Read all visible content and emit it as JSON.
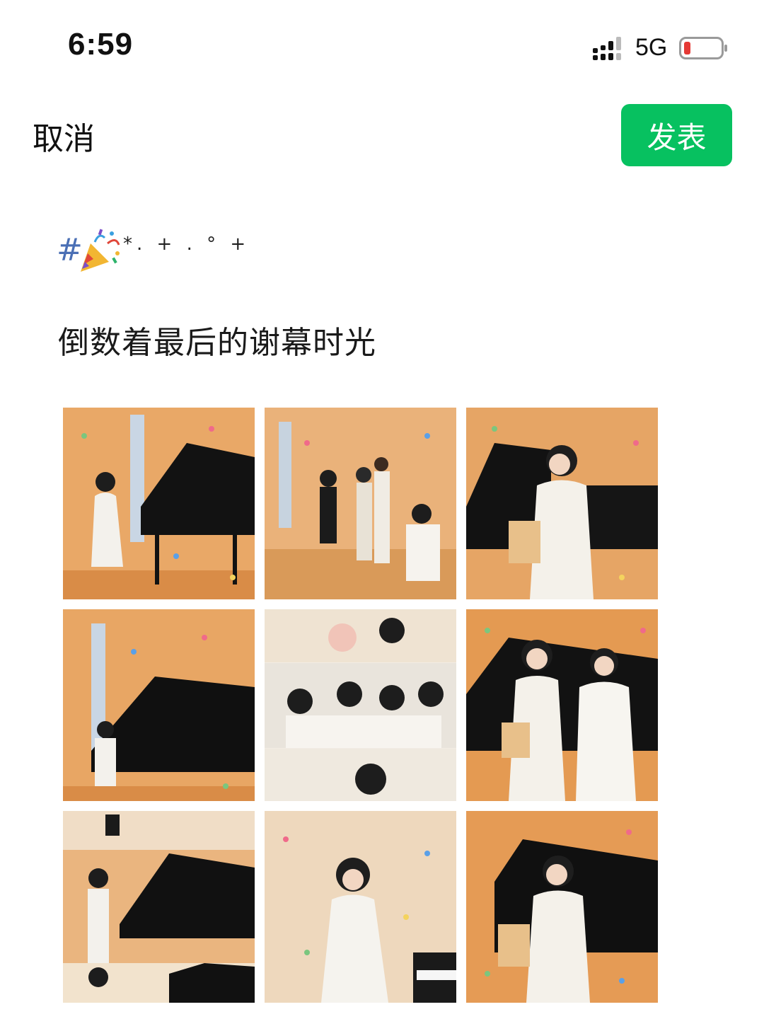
{
  "status_bar": {
    "time": "6:59",
    "network": "5G",
    "icons": [
      "signal-bars-icon",
      "battery-low-icon"
    ],
    "battery_color": "#e53935"
  },
  "header": {
    "cancel_label": "取消",
    "publish_label": "发表",
    "publish_color": "#07c160"
  },
  "post": {
    "emoji_prefix": "#",
    "emoji_icon": "party-popper-icon",
    "emoji_suffix": "*. + . ° +",
    "caption": "倒数着最后的谢幕时光"
  },
  "photos": [
    {
      "description_icon": "photo-thumbnail"
    },
    {
      "description_icon": "photo-thumbnail"
    },
    {
      "description_icon": "photo-thumbnail"
    },
    {
      "description_icon": "photo-thumbnail"
    },
    {
      "description_icon": "photo-thumbnail"
    },
    {
      "description_icon": "photo-thumbnail"
    },
    {
      "description_icon": "photo-thumbnail"
    },
    {
      "description_icon": "photo-thumbnail"
    },
    {
      "description_icon": "photo-thumbnail"
    }
  ]
}
